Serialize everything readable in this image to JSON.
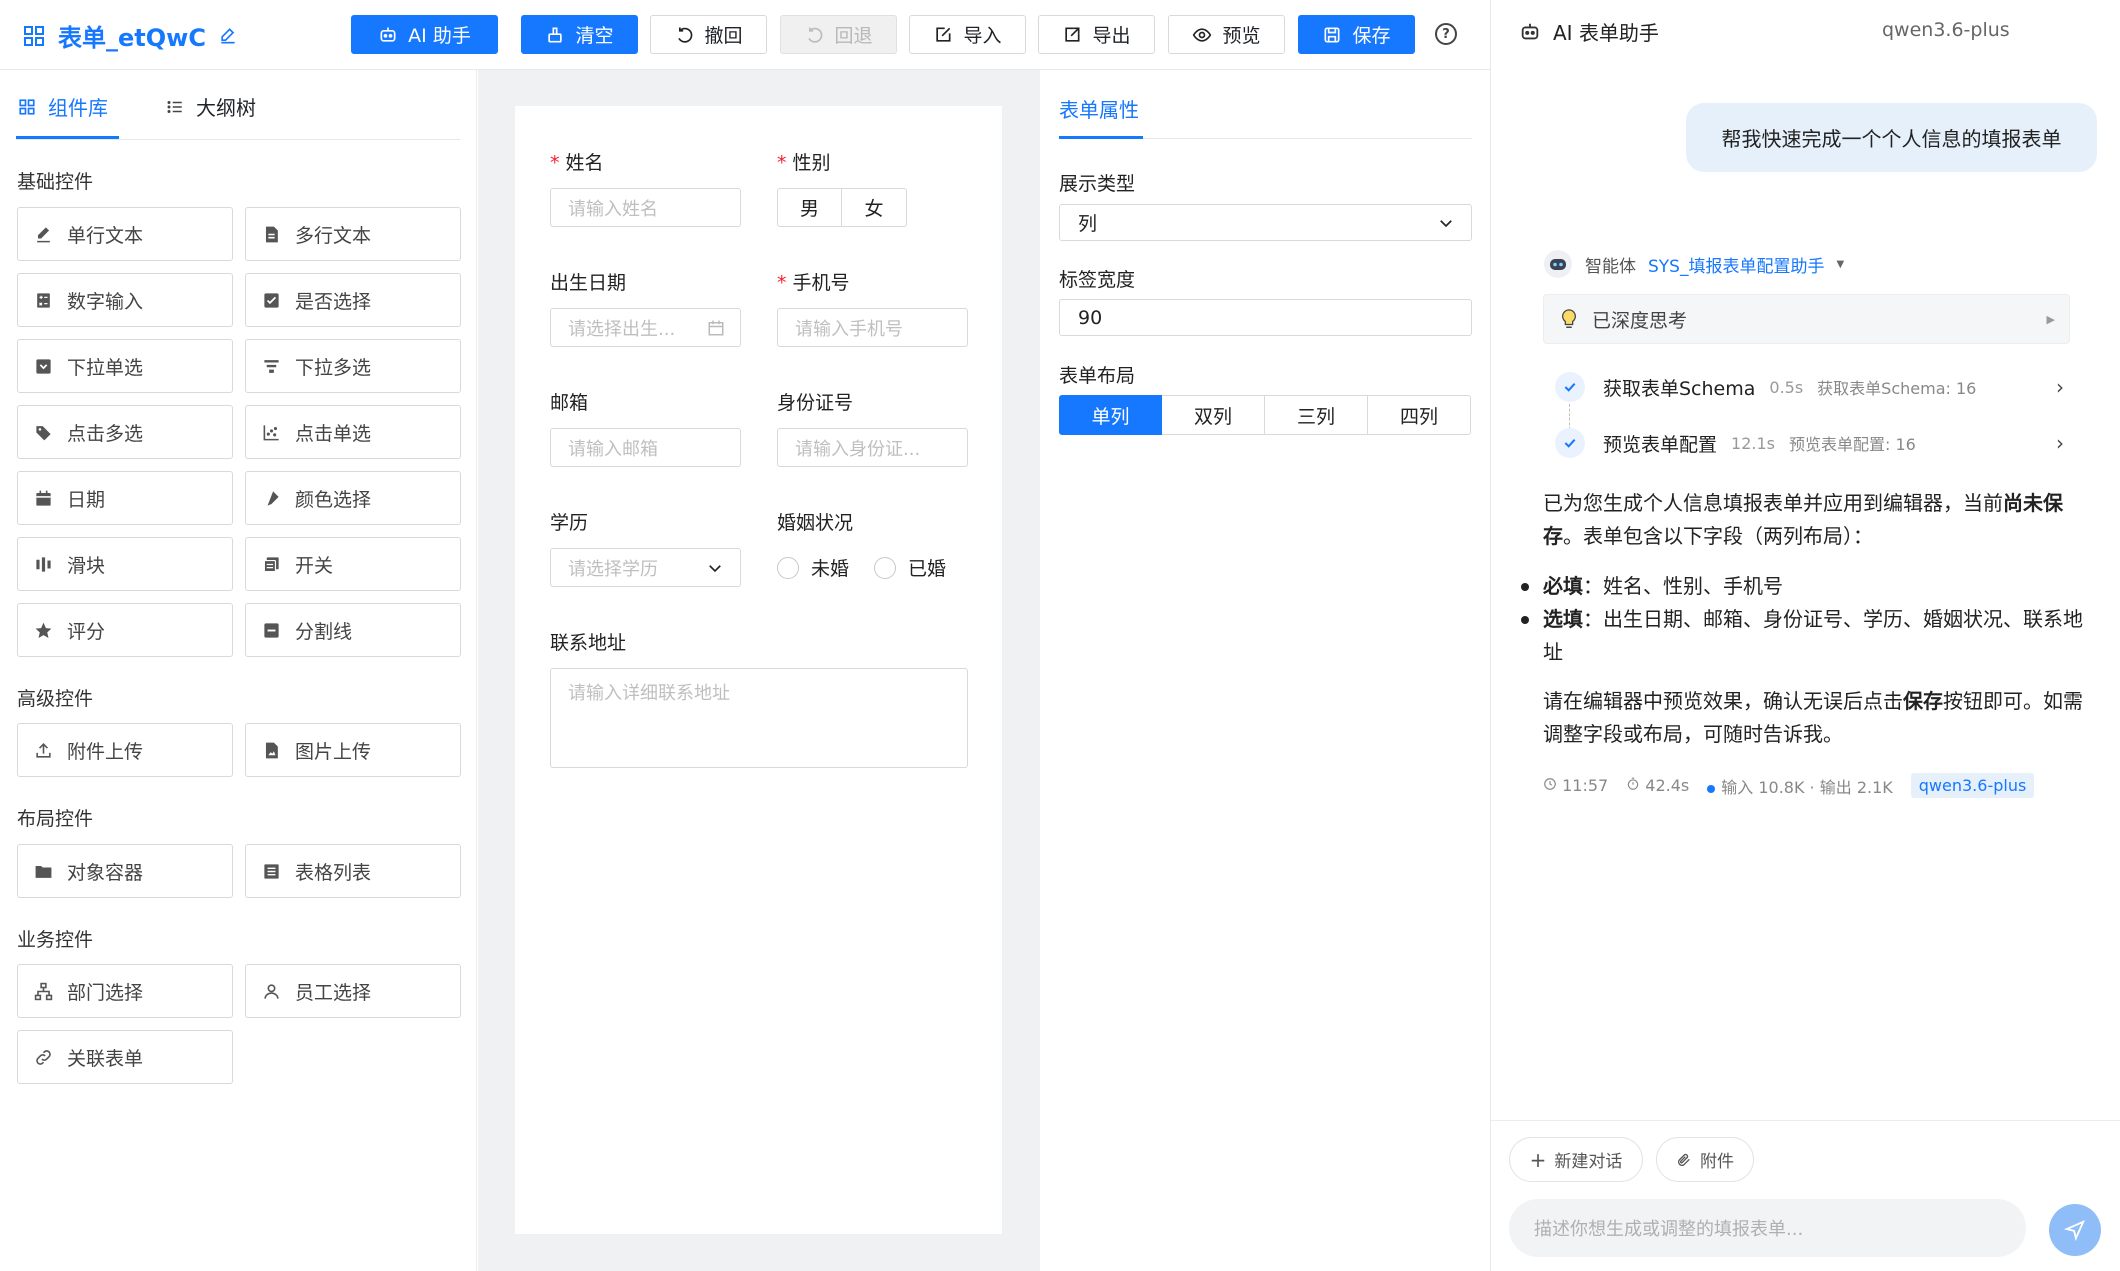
{
  "header": {
    "title": "表单_etQwC",
    "buttons": {
      "ai": "AI 助手",
      "clear": "清空",
      "undo": "撤回",
      "redo": "回退",
      "import": "导入",
      "export": "导出",
      "preview": "预览",
      "save": "保存"
    },
    "help": "?"
  },
  "left_panel": {
    "tabs": [
      "组件库",
      "大纲树"
    ],
    "sections": {
      "basic": "基础控件",
      "advanced": "高级控件",
      "layout": "布局控件",
      "business": "业务控件"
    },
    "basic": [
      "单行文本",
      "多行文本",
      "数字输入",
      "是否选择",
      "下拉单选",
      "下拉多选",
      "点击多选",
      "点击单选",
      "日期",
      "颜色选择",
      "滑块",
      "开关",
      "评分",
      "分割线"
    ],
    "advanced": [
      "附件上传",
      "图片上传"
    ],
    "layout": [
      "对象容器",
      "表格列表"
    ],
    "business": [
      "部门选择",
      "员工选择",
      "关联表单"
    ]
  },
  "form": {
    "name": {
      "label": "姓名",
      "placeholder": "请输入姓名"
    },
    "gender": {
      "label": "性别",
      "options": [
        "男",
        "女"
      ]
    },
    "birthday": {
      "label": "出生日期",
      "placeholder": "请选择出生..."
    },
    "phone": {
      "label": "手机号",
      "placeholder": "请输入手机号"
    },
    "email": {
      "label": "邮箱",
      "placeholder": "请输入邮箱"
    },
    "idcard": {
      "label": "身份证号",
      "placeholder": "请输入身份证..."
    },
    "education": {
      "label": "学历",
      "placeholder": "请选择学历"
    },
    "marital": {
      "label": "婚姻状况",
      "options": [
        "未婚",
        "已婚"
      ]
    },
    "address": {
      "label": "联系地址",
      "placeholder": "请输入详细联系地址"
    }
  },
  "properties": {
    "tab": "表单属性",
    "display_type": {
      "label": "展示类型",
      "value": "列"
    },
    "label_width": {
      "label": "标签宽度",
      "value": "90"
    },
    "layout": {
      "label": "表单布局",
      "options": [
        "单列",
        "双列",
        "三列",
        "四列"
      ],
      "selected": "单列"
    }
  },
  "chat": {
    "title": "AI 表单助手",
    "model": "qwen3.6-plus",
    "user_message": "帮我快速完成一个个人信息的填报表单",
    "agent_prefix": "智能体",
    "agent_name": "SYS_填报表单配置助手",
    "thinking": "已深度思考",
    "steps": [
      {
        "name": "获取表单Schema",
        "duration": "0.5s",
        "detail": "获取表单Schema: 16"
      },
      {
        "name": "预览表单配置",
        "duration": "12.1s",
        "detail": "预览表单配置: 16"
      }
    ],
    "reply": {
      "p1a": "已为您生成个人信息填报表单并应用到编辑器，当前",
      "p1b": "尚未保存",
      "p1c": "。表单包含以下字段（两列布局）：",
      "b1k": "必填",
      "b1v": "：姓名、性别、手机号",
      "b2k": "选填",
      "b2v": "：出生日期、邮箱、身份证号、学历、婚姻状况、联系地址",
      "p2a": "请在编辑器中预览效果，确认无误后点击",
      "p2b": "保存",
      "p2c": "按钮即可。如需调整字段或布局，可随时告诉我。"
    },
    "meta": {
      "time": "11:57",
      "elapsed": "42.4s",
      "tokens": "输入 10.8K · 输出 2.1K",
      "model_tag": "qwen3.6-plus"
    },
    "new_chat": "新建对话",
    "attach": "附件",
    "input_placeholder": "描述你想生成或调整的填报表单..."
  },
  "colors": {
    "primary": "#1677ff",
    "required": "#f5222d",
    "canvas_bg": "#f0f1f3"
  }
}
